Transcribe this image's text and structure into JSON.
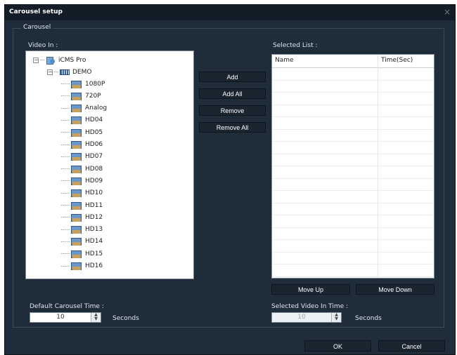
{
  "window": {
    "title": "Carousel setup",
    "close_glyph": "×"
  },
  "carousel": {
    "group_label": "Carousel",
    "video_in_label": "Video In :",
    "tree": {
      "root": "iCMS Pro",
      "group": "DEMO",
      "cameras": [
        "1080P",
        "720P",
        "Analog",
        "HD04",
        "HD05",
        "HD06",
        "HD07",
        "HD08",
        "HD09",
        "HD10",
        "HD11",
        "HD12",
        "HD13",
        "HD14",
        "HD15",
        "HD16"
      ]
    },
    "buttons": {
      "add": "Add",
      "add_all": "Add All",
      "remove": "Remove",
      "remove_all": "Remove All"
    },
    "selected_list": {
      "label": "Selected List :",
      "columns": [
        "Name",
        "Time(Sec)"
      ],
      "rows": []
    },
    "move_up": "Move Up",
    "move_down": "Move Down",
    "default_time": {
      "label": "Default Carousel Time :",
      "value": "10",
      "unit": "Seconds"
    },
    "selected_time": {
      "label": "Selected Video In Time :",
      "value": "10",
      "unit": "Seconds"
    }
  },
  "footer": {
    "ok": "OK",
    "cancel": "Cancel"
  }
}
